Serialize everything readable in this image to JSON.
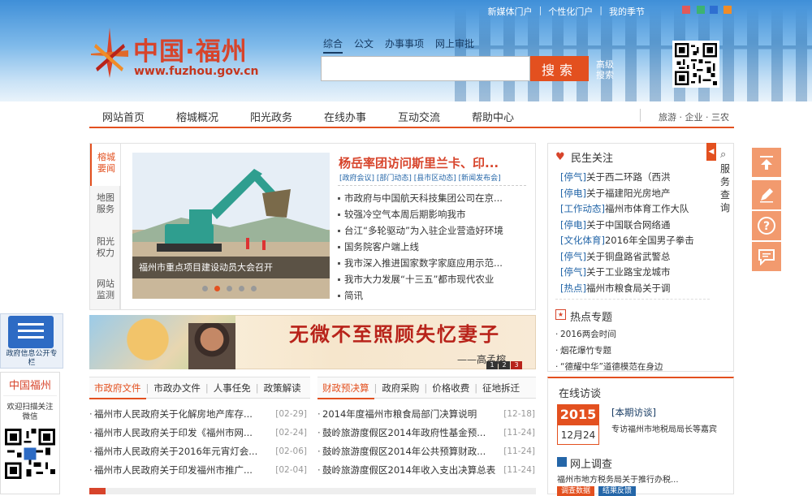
{
  "header": {
    "top_links": [
      "新媒体门户",
      "个性化门户",
      "我的季节"
    ],
    "skin_colors": [
      "#e05a5a",
      "#3cb371",
      "#2e6fd1",
      "#f08c28"
    ],
    "logo_cn": "中国·福州",
    "logo_url": "www.fuzhou.gov.cn"
  },
  "search": {
    "tabs": [
      "综合",
      "公文",
      "办事事项",
      "网上审批"
    ],
    "placeholder": "",
    "button": "搜索",
    "advanced": "高级搜索"
  },
  "nav": {
    "items": [
      "网站首页",
      "榕城概况",
      "阳光政务",
      "在线办事",
      "互动交流",
      "帮助中心"
    ],
    "right": "旅游 · 企业 · 三农"
  },
  "side_tabs": [
    "榕城要闻",
    "地图服务",
    "阳光权力",
    "网站监测"
  ],
  "feature": {
    "photo_caption": "福州市重点项目建设动员大会召开",
    "headline": "杨岳率团访问斯里兰卡、印...",
    "tags": "[政府会议] [部门动态] [县市区动态] [新闻发布会]",
    "news": [
      "市政府与中国航天科技集团公司在京...",
      "较强冷空气本周后期影响我市",
      "台江“多轮驱动”为入驻企业营造好环境",
      "国务院客户端上线",
      "我市深入推进国家数字家庭应用示范...",
      "我市大力发展“十三五”都市现代农业",
      "简讯"
    ]
  },
  "banner": {
    "title": "无微不至照顾失忆妻子",
    "signature": "——高孟榕",
    "pages": [
      "1",
      "2",
      "3"
    ]
  },
  "tabs_left": {
    "tabs": [
      "市政府文件",
      "市政办文件",
      "人事任免",
      "政策解读"
    ],
    "items": [
      {
        "title": "福州市人民政府关于化解房地产库存...",
        "date": "[02-29]"
      },
      {
        "title": "福州市人民政府关于印发《福州市网...",
        "date": "[02-24]"
      },
      {
        "title": "福州市人民政府关于2016年元宵灯会...",
        "date": "[02-06]"
      },
      {
        "title": "福州市人民政府关于印发福州市推广...",
        "date": "[02-04]"
      }
    ]
  },
  "tabs_right": {
    "tabs": [
      "财政预决算",
      "政府采购",
      "价格收费",
      "征地拆迁"
    ],
    "items": [
      {
        "title": "2014年度福州市粮食局部门决算说明",
        "date": "[12-18]"
      },
      {
        "title": "鼓岭旅游度假区2014年政府性基金预...",
        "date": "[11-24]"
      },
      {
        "title": "鼓岭旅游度假区2014年公共预算财政...",
        "date": "[11-24]"
      },
      {
        "title": "鼓岭旅游度假区2014年收入支出决算总表",
        "date": "[11-24]"
      }
    ]
  },
  "minsheng": {
    "title": "民生关注",
    "service": "服务查询",
    "items": [
      {
        "tag": "[停气]",
        "text": "关于西二环路（西洪"
      },
      {
        "tag": "[停电]",
        "text": "关于福建阳光房地产"
      },
      {
        "tag": "[工作动态]",
        "text": "福州市体育工作大队"
      },
      {
        "tag": "[停电]",
        "text": "关于中国联合网络通"
      },
      {
        "tag": "[文化体育]",
        "text": "2016年全国男子拳击"
      },
      {
        "tag": "[停气]",
        "text": "关于铜盘路省武警总"
      },
      {
        "tag": "[停气]",
        "text": "关于工业路宝龙城市"
      },
      {
        "tag": "[热点]",
        "text": "福州市粮食局关于调"
      }
    ]
  },
  "hot": {
    "title": "热点专题",
    "items": [
      "2016两会时间",
      "烟花爆竹专题",
      "“德耀中华”道德模范在身边"
    ]
  },
  "online": {
    "title": "在线访谈",
    "year": "2015",
    "month_day": "12月24",
    "tag": "[本期访谈]",
    "text": "专访福州市地税局局长等嘉宾",
    "survey_title": "网上调查",
    "survey_text": "福州市地方税务局关于推行办税...",
    "survey_btn1": "调查数据",
    "survey_btn2": "结果反馈"
  },
  "left_float": {
    "gov_info": "政府信息公开专栏",
    "wx_title": "中国福州",
    "wx_text": "欢迎扫描关注微信"
  },
  "float_tools": [
    "top-icon",
    "edit-icon",
    "help-icon",
    "chat-icon"
  ]
}
